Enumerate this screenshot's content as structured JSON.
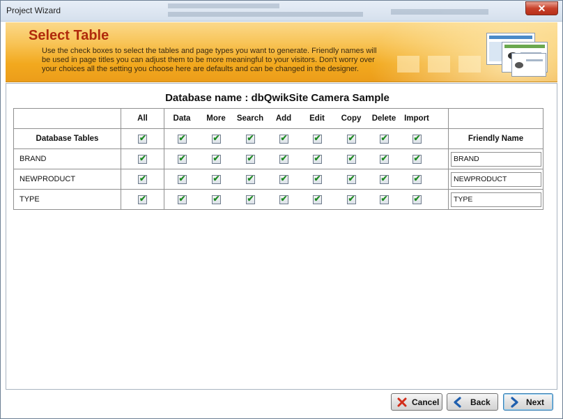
{
  "window": {
    "title": "Project Wizard",
    "close_glyph": "✕"
  },
  "banner": {
    "title": "Select Table",
    "description": "Use the check boxes to select the tables and page types you want to generate. Friendly names will be used in page titles you can adjust them to be more meaningful to your visitors. Don't worry over your choices all the setting you choose here are defaults and can be changed in the designer.",
    "illustration_icon": "website-thumbnails-icon"
  },
  "database": {
    "name_label": "Database name : dbQwikSite Camera Sample"
  },
  "grid": {
    "corner_header": "Database Tables",
    "all_header": "All",
    "friendly_header": "Friendly Name",
    "page_types": [
      "Data",
      "More",
      "Search",
      "Add",
      "Edit",
      "Copy",
      "Delete",
      "Import"
    ],
    "header_checks": {
      "all": true,
      "types": [
        true,
        true,
        true,
        true,
        true,
        true,
        true,
        true
      ]
    },
    "rows": [
      {
        "table": "BRAND",
        "all": true,
        "types": [
          true,
          true,
          true,
          true,
          true,
          true,
          true,
          true
        ],
        "friendly_name": "BRAND"
      },
      {
        "table": "NEWPRODUCT",
        "all": true,
        "types": [
          true,
          true,
          true,
          true,
          true,
          true,
          true,
          true
        ],
        "friendly_name": "NEWPRODUCT"
      },
      {
        "table": "TYPE",
        "all": true,
        "types": [
          true,
          true,
          true,
          true,
          true,
          true,
          true,
          true
        ],
        "friendly_name": "TYPE"
      }
    ],
    "check_glyph": "✔",
    "check_color": "#1e8a24"
  },
  "buttons": {
    "cancel": {
      "label": "Cancel",
      "icon": "red-x-icon"
    },
    "back": {
      "label": "Back",
      "icon": "back-arrow-icon"
    },
    "next": {
      "label": "Next",
      "icon": "next-arrow-icon"
    }
  },
  "colors": {
    "banner_title": "#b02a0c",
    "banner_bg": "#f8c457",
    "accent_blue": "#1f5fae"
  }
}
